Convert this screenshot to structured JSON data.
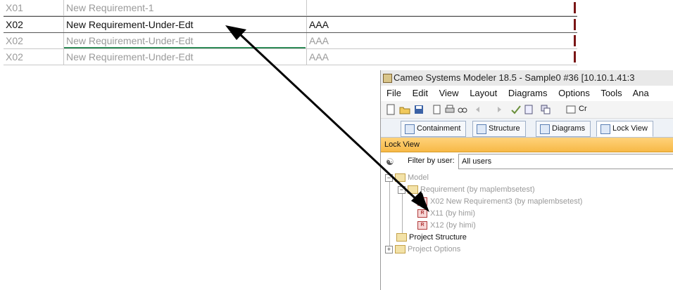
{
  "sheet": {
    "rows": [
      {
        "id": "X01",
        "name": "New Requirement-1",
        "text": ""
      },
      {
        "id": "X02",
        "name": "New Requirement-Under-Edt",
        "text": "AAA"
      },
      {
        "id": "X02",
        "name": "New Requirement-Under-Edt",
        "text": "AAA"
      },
      {
        "id": "X02",
        "name": "New Requirement-Under-Edt",
        "text": "AAA"
      }
    ]
  },
  "window": {
    "title": "Cameo Systems Modeler 18.5 - Sample0 #36  [10.10.1.41:3",
    "menu": [
      "File",
      "Edit",
      "View",
      "Layout",
      "Diagrams",
      "Options",
      "Tools",
      "Ana"
    ],
    "toolbar_label": "Cr",
    "tabs": [
      "Containment",
      "Structure",
      "Diagrams",
      "Lock View"
    ]
  },
  "lock_view": {
    "header": "Lock View",
    "filter_label": "Filter by user:",
    "filter_value": "All users"
  },
  "tree": {
    "model": "Model",
    "requirement": "Requirement",
    "requirement_by": "(by maplembsetest)",
    "x02": "X02 New Requirement3",
    "x02_by": "(by maplembsetest)",
    "x11": "X11",
    "x11_by": "(by himi)",
    "x12": "X12",
    "x12_by": "(by himi)",
    "project_structure": "Project Structure",
    "project_options": "Project Options",
    "req_badge": "R"
  },
  "colors": {
    "arrow": "#000000",
    "lock_header": "#f7b947",
    "edit_underline": "#2e8b57"
  }
}
